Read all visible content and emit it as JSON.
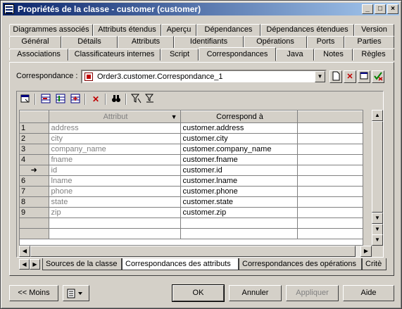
{
  "window": {
    "title": "Propriétés de la classe - customer (customer)",
    "controls": [
      "_",
      "□",
      "×"
    ]
  },
  "tabs": {
    "row1": [
      "Diagrammes associés",
      "Attributs étendus",
      "Aperçu",
      "Dépendances",
      "Dépendances étendues",
      "Version"
    ],
    "row2": [
      "Général",
      "Détails",
      "Attributs",
      "Identifiants",
      "Opérations",
      "Ports",
      "Parties"
    ],
    "row3": [
      "Associations",
      "Classificateurs internes",
      "Script",
      "Correspondances",
      "Java",
      "Notes",
      "Règles"
    ],
    "active": "Correspondances"
  },
  "correspondance": {
    "label": "Correspondance :",
    "value": "Order3.customer.Correspondance_1"
  },
  "grid": {
    "columns": [
      "Attribut",
      "Correspond à"
    ],
    "rows": [
      {
        "num": "1",
        "attribut": "address",
        "correspond": "customer.address"
      },
      {
        "num": "2",
        "attribut": "city",
        "correspond": "customer.city"
      },
      {
        "num": "3",
        "attribut": "company_name",
        "correspond": "customer.company_name"
      },
      {
        "num": "4",
        "attribut": "fname",
        "correspond": "customer.fname"
      },
      {
        "num": "➜",
        "attribut": "id",
        "correspond": "customer.id"
      },
      {
        "num": "6",
        "attribut": "lname",
        "correspond": "customer.lname"
      },
      {
        "num": "7",
        "attribut": "phone",
        "correspond": "customer.phone"
      },
      {
        "num": "8",
        "attribut": "state",
        "correspond": "customer.state"
      },
      {
        "num": "9",
        "attribut": "zip",
        "correspond": "customer.zip"
      }
    ]
  },
  "subtabs": [
    "Sources de la classe",
    "Correspondances des attributs",
    "Correspondances des opérations",
    "Critè"
  ],
  "subtab_active": "Correspondances des attributs",
  "footer": {
    "less": "<< Moins",
    "ok": "OK",
    "cancel": "Annuler",
    "apply": "Appliquer",
    "help": "Aide"
  }
}
